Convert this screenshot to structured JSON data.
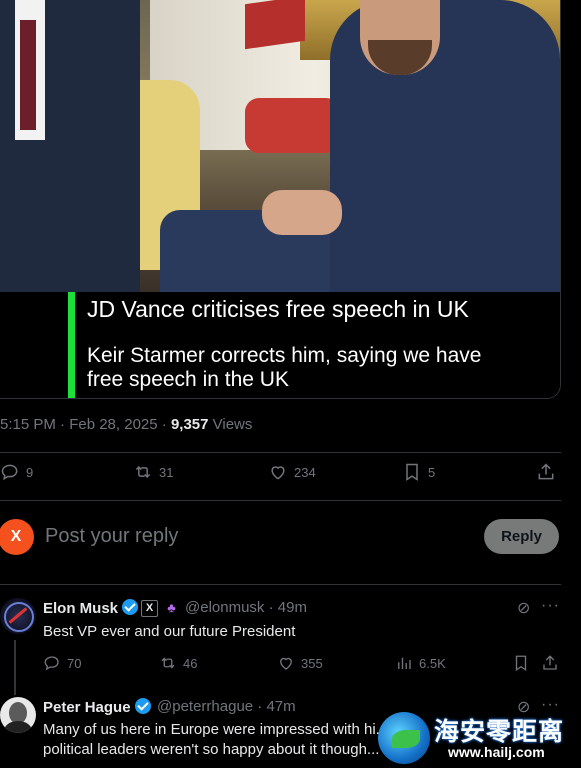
{
  "video": {
    "caption_line1": "JD Vance criticises free speech in UK",
    "caption_line2": "Keir Starmer corrects him, saying we have free speech in the UK",
    "accent_color": "#1ee03a"
  },
  "post_meta": {
    "time_date": "5:15 PM · Feb 28, 2025 · ",
    "views_count": "9,357",
    "views_label": " Views"
  },
  "actions": {
    "replies": "9",
    "reposts": "31",
    "likes": "234",
    "bookmarks": "5",
    "icons": [
      "reply-icon",
      "repost-icon",
      "like-icon",
      "bookmark-icon",
      "share-icon"
    ]
  },
  "composer": {
    "avatar_letter": "X",
    "placeholder": "Post your reply",
    "reply_label": "Reply"
  },
  "replies": [
    {
      "name": "Elon Musk",
      "x_badge": "X",
      "handle_time": "@elonmusk · 49m",
      "text": "Best VP ever and our future President",
      "stats": {
        "replies": "70",
        "reposts": "46",
        "likes": "355",
        "views": "6.5K"
      }
    },
    {
      "name": "Peter Hague",
      "handle_time": "@peterrhague · 47m",
      "text": "Many of us here in Europe were impressed with hi... political leaders weren't so happy about it though..."
    }
  ],
  "watermark": {
    "title": "海安零距离",
    "url": "www.hailj.com"
  },
  "colors": {
    "background": "#000000",
    "text": "#e7e9ea",
    "muted": "#71767b",
    "verified": "#1d9bf0",
    "avatar_x": "#f4511e",
    "reply_button": "#787a7a"
  }
}
